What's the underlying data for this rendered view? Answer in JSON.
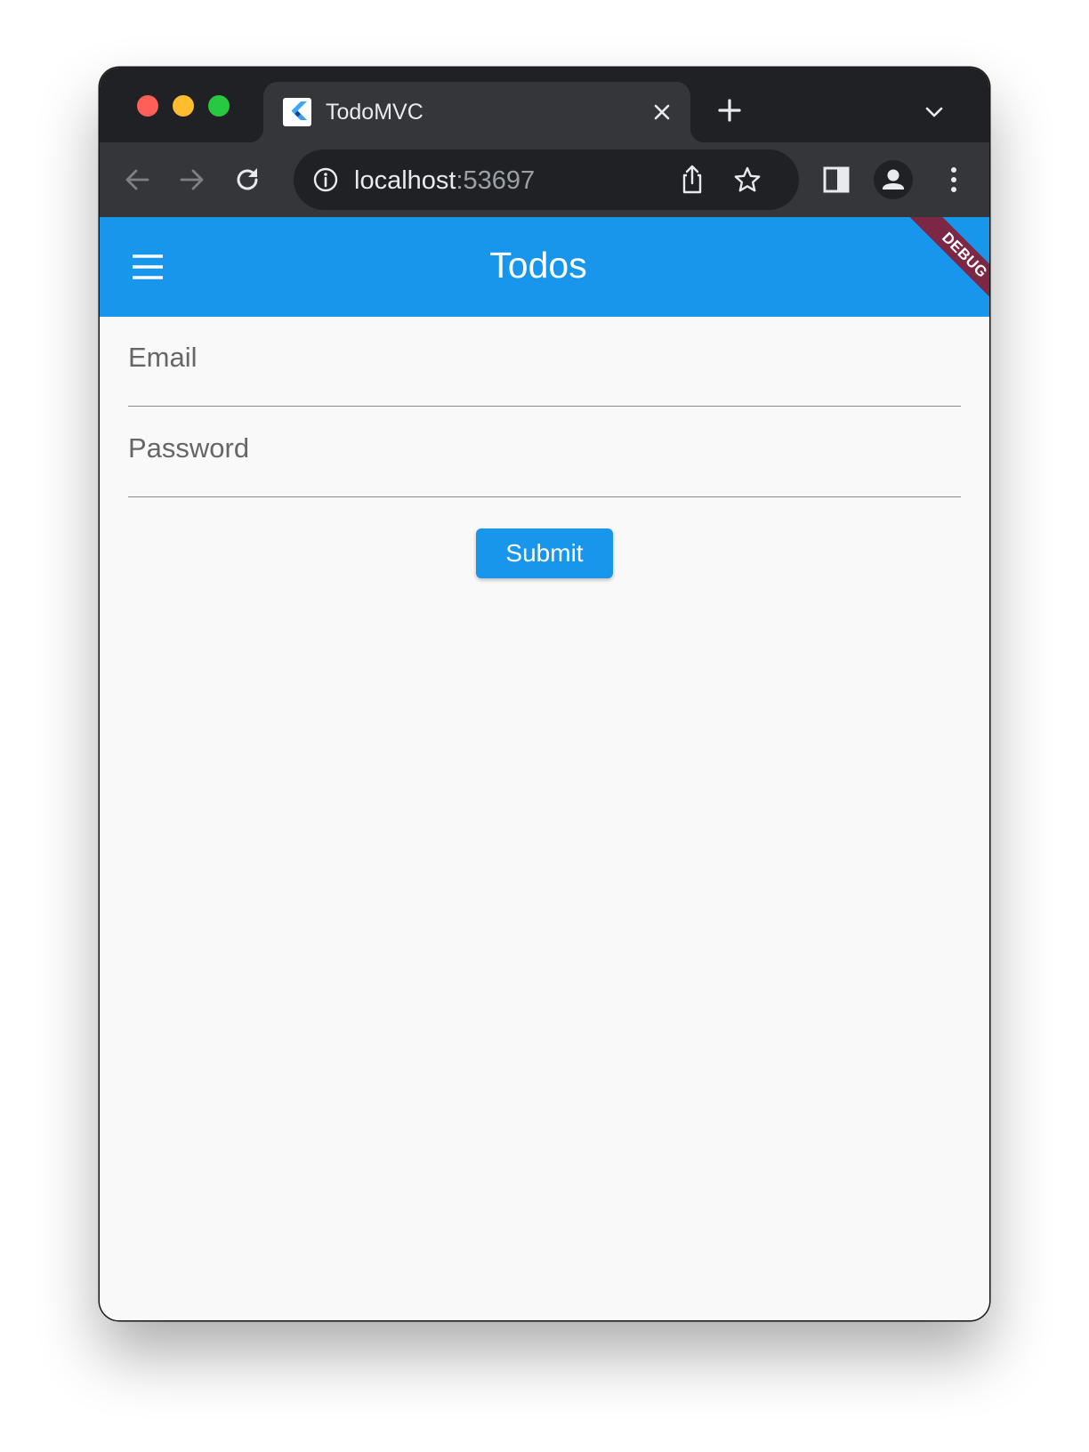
{
  "browser": {
    "tab": {
      "title": "TodoMVC",
      "favicon": "flutter-logo-icon"
    },
    "url": {
      "host": "localhost",
      "port": ":53697"
    },
    "icons": [
      "back-icon",
      "forward-icon",
      "reload-icon",
      "site-info-icon",
      "share-icon",
      "bookmark-star-icon",
      "side-panel-icon",
      "profile-icon",
      "more-menu-icon",
      "new-tab-icon",
      "tab-search-dropdown-icon",
      "close-tab-icon"
    ]
  },
  "app": {
    "title": "Todos",
    "debug_banner": "DEBUG",
    "primary_color": "#1796ec",
    "debug_color": "#7c2745",
    "form": {
      "email_placeholder": "Email",
      "password_placeholder": "Password",
      "submit_label": "Submit"
    }
  }
}
